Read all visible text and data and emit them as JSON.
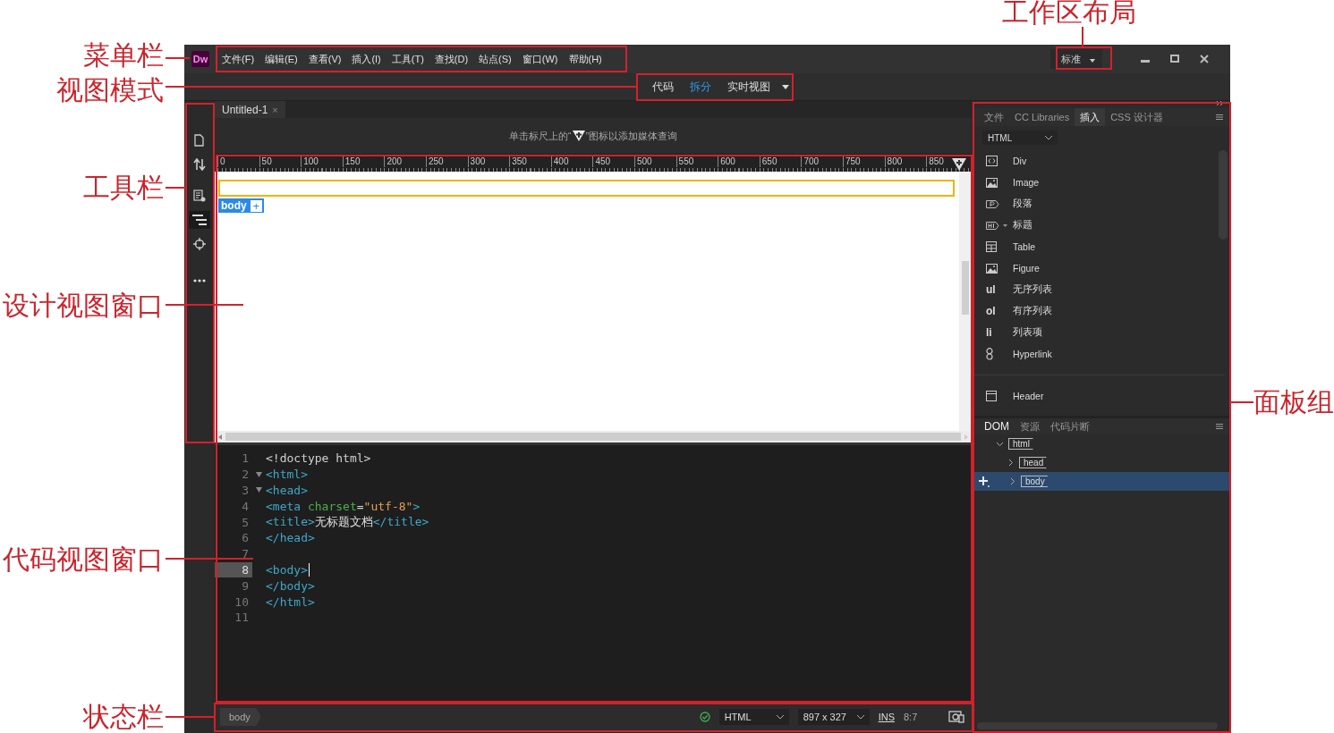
{
  "callouts": {
    "workspace_layout": "工作区布局",
    "menu_bar": "菜单栏",
    "view_modes": "视图模式",
    "toolbar": "工具栏",
    "design_view": "设计视图窗口",
    "code_view": "代码视图窗口",
    "status_bar": "状态栏",
    "panel_group": "面板组"
  },
  "app": {
    "logo": "Dw"
  },
  "menu": [
    "文件(F)",
    "编辑(E)",
    "查看(V)",
    "插入(I)",
    "工具(T)",
    "查找(D)",
    "站点(S)",
    "窗口(W)",
    "帮助(H)"
  ],
  "workspace": {
    "label": "标准"
  },
  "view_modes": [
    {
      "label": "代码",
      "selected": false
    },
    {
      "label": "拆分",
      "selected": true
    },
    {
      "label": "实时视图",
      "selected": false
    }
  ],
  "tools": [
    {
      "kind": "file",
      "selected": false
    },
    {
      "kind": "sort",
      "selected": false
    },
    {
      "kind": "inspect",
      "selected": false
    },
    {
      "kind": "outline",
      "selected": true
    },
    {
      "kind": "target",
      "selected": false
    },
    {
      "kind": "more",
      "selected": false
    }
  ],
  "document": {
    "tab": "Untitled-1",
    "close": "×",
    "media_hint_before": "单击标尺上的“",
    "media_hint_after": "”图标以添加媒体查询",
    "ruler_ticks": [
      "0",
      "50",
      "100",
      "150",
      "200",
      "250",
      "300",
      "350",
      "400",
      "450",
      "500",
      "550",
      "600",
      "650",
      "700",
      "750",
      "800",
      "850"
    ],
    "element_tag": "body",
    "add": "+"
  },
  "code_lines": [
    {
      "number": "1",
      "fold": false,
      "current": false,
      "tokens": [
        {
          "color": "#d0d0d0",
          "text": "<!doctype html>"
        }
      ]
    },
    {
      "number": "2",
      "fold": true,
      "current": false,
      "tokens": [
        {
          "color": "#3fa7c9",
          "text": "<html>"
        }
      ]
    },
    {
      "number": "3",
      "fold": true,
      "current": false,
      "tokens": [
        {
          "color": "#3fa7c9",
          "text": "<head>"
        }
      ]
    },
    {
      "number": "4",
      "fold": false,
      "current": false,
      "tokens": [
        {
          "color": "#3fa7c9",
          "text": "<meta "
        },
        {
          "color": "#4cae4c",
          "text": "charset"
        },
        {
          "color": "#d0d0d0",
          "text": "="
        },
        {
          "color": "#e3a052",
          "text": "\"utf-8\""
        },
        {
          "color": "#3fa7c9",
          "text": ">"
        }
      ]
    },
    {
      "number": "5",
      "fold": false,
      "current": false,
      "tokens": [
        {
          "color": "#3fa7c9",
          "text": "<title>"
        },
        {
          "color": "#e0e0e0",
          "text": "无标题文档"
        },
        {
          "color": "#3fa7c9",
          "text": "</title>"
        }
      ]
    },
    {
      "number": "6",
      "fold": false,
      "current": false,
      "tokens": [
        {
          "color": "#3fa7c9",
          "text": "</head>"
        }
      ]
    },
    {
      "number": "7",
      "fold": false,
      "current": false
    },
    {
      "number": "8",
      "fold": false,
      "current": true,
      "tokens": [
        {
          "color": "#3fa7c9",
          "text": "<body>"
        }
      ]
    },
    {
      "number": "9",
      "fold": false,
      "current": false,
      "tokens": [
        {
          "color": "#3fa7c9",
          "text": "</body>"
        }
      ]
    },
    {
      "number": "10",
      "fold": false,
      "current": false,
      "tokens": [
        {
          "color": "#3fa7c9",
          "text": "</html>"
        }
      ]
    },
    {
      "number": "11",
      "fold": false,
      "current": false
    }
  ],
  "status": {
    "tag": "body",
    "valid": true,
    "language": "HTML",
    "size": "897 x 327",
    "mode": "INS",
    "position": "8:7"
  },
  "panel": {
    "tabs": [
      {
        "label": "文件",
        "selected": false
      },
      {
        "label": "CC Libraries",
        "selected": false
      },
      {
        "label": "插入",
        "selected": true
      },
      {
        "label": "CSS 设计器",
        "selected": false
      }
    ],
    "category": "HTML",
    "items": [
      {
        "kind": "div",
        "label": "Div"
      },
      {
        "kind": "image",
        "label": "Image"
      },
      {
        "kind": "paragraph",
        "label": "段落"
      },
      {
        "kind": "heading",
        "label": "标题"
      },
      {
        "kind": "table",
        "label": "Table"
      },
      {
        "kind": "figure",
        "label": "Figure"
      },
      {
        "kind": "glyph",
        "glyph": "ul",
        "label": "无序列表"
      },
      {
        "kind": "glyph",
        "glyph": "ol",
        "label": "有序列表"
      },
      {
        "kind": "glyph",
        "glyph": "li",
        "label": "列表项"
      },
      {
        "kind": "link",
        "label": "Hyperlink"
      }
    ],
    "items_2": [
      {
        "kind": "header",
        "label": "Header"
      }
    ]
  },
  "dom_panel": {
    "tabs": [
      {
        "label": "DOM",
        "selected": true
      },
      {
        "label": "资源",
        "selected": false
      },
      {
        "label": "代码片断",
        "selected": false
      }
    ],
    "tree": [
      {
        "tag": "html",
        "expanded": true,
        "selected": false,
        "children": [
          {
            "tag": "head",
            "expanded": false,
            "selected": false
          },
          {
            "tag": "body",
            "expanded": false,
            "selected": true
          }
        ]
      }
    ]
  }
}
